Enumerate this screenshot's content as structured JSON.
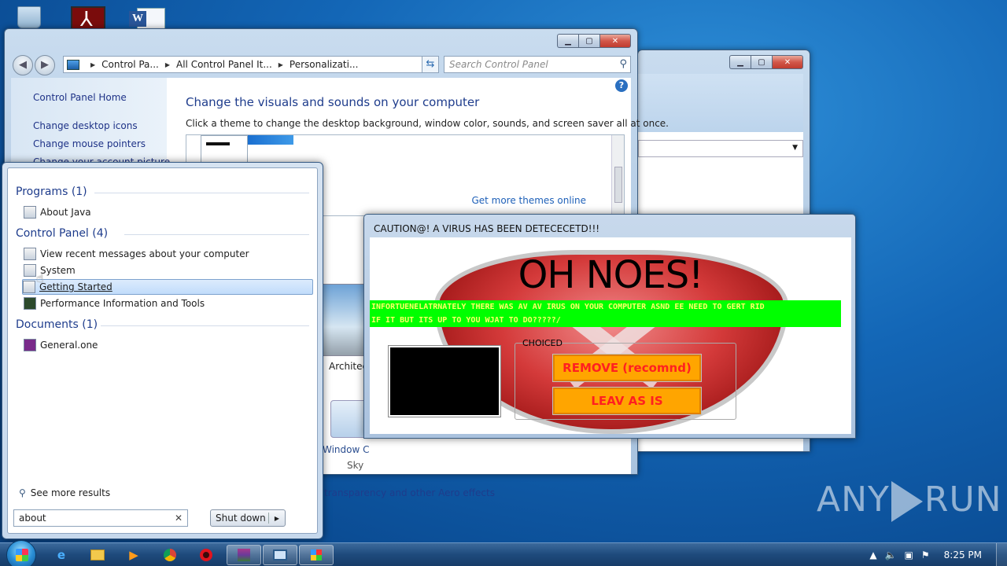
{
  "control_panel": {
    "address": {
      "crumb1": "Control Pa...",
      "crumb2": "All Control Panel It...",
      "crumb3": "Personalizati..."
    },
    "search_placeholder": "Search Control Panel",
    "sidebar": {
      "home": "Control Panel Home",
      "link1": "Change desktop icons",
      "link2": "Change mouse pointers",
      "link3": "Change your account picture"
    },
    "title": "Change the visuals and sounds on your computer",
    "subtitle": "Click a theme to change the desktop background, window color, sounds, and screen saver all at once.",
    "more_themes": "Get more themes online",
    "theme_label": "Architect",
    "window_color_label": "Window C",
    "window_color_value": "Sky",
    "aero_text": "transparency and other Aero effects"
  },
  "start_menu": {
    "groups": [
      {
        "heading": "Programs (1)",
        "items": [
          "About Java"
        ]
      },
      {
        "heading": "Control Panel (4)",
        "items": [
          "View recent messages about your computer",
          "System",
          "Getting Started",
          "Performance Information and Tools"
        ]
      },
      {
        "heading": "Documents (1)",
        "items": [
          "General.one"
        ]
      }
    ],
    "see_more": "See more results",
    "search_value": "about",
    "shutdown_label": "Shut down"
  },
  "virus_popup": {
    "title": "CAUTION@! A VIRUS HAS BEEN DETECECETD!!!",
    "headline": "OH NOES!",
    "message_line1": "INFORTUENELATRNATELY THERE WAS AV AV IRUS ON YOUR COMPUTER ASND EE NEED TO GERT RID",
    "message_line2": "IF IT BUT ITS UP TO YOU WJAT TO DO?????/",
    "group_label": "CHOICED",
    "remove_label": "REMOVE (recomnd)",
    "leave_label": "LEAV AS IS"
  },
  "watermark": {
    "left": "ANY",
    "right": "RUN"
  },
  "taskbar": {
    "clock": "8:25 PM",
    "pinned": [
      "ie-icon",
      "folder-icon",
      "media-player-icon",
      "chrome-icon",
      "opera-icon",
      "winrar-icon",
      "remote-icon",
      "control-panel-icon"
    ]
  },
  "colors": {
    "desktop": "#1366b6",
    "green_banner": "#00ff00",
    "button_orange": "#ffa500",
    "button_text": "#ff2020"
  }
}
